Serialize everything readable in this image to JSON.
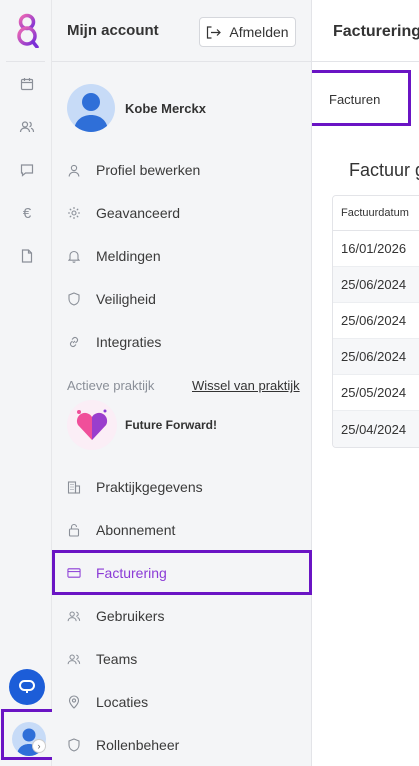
{
  "header": {
    "title": "Mijn account",
    "logout_label": "Afmelden"
  },
  "user": {
    "name": "Kobe Merckx"
  },
  "menu": {
    "items": [
      {
        "label": "Profiel bewerken",
        "icon": "user-icon"
      },
      {
        "label": "Geavanceerd",
        "icon": "gear-icon"
      },
      {
        "label": "Meldingen",
        "icon": "bell-icon"
      },
      {
        "label": "Veiligheid",
        "icon": "shield-icon"
      },
      {
        "label": "Integraties",
        "icon": "link-icon"
      }
    ],
    "practice_section_label": "Actieve praktijk",
    "switch_practice_label": "Wissel van praktijk",
    "practice_name": "Future Forward!",
    "practice_items": [
      {
        "label": "Praktijkgegevens",
        "icon": "building-icon"
      },
      {
        "label": "Abonnement",
        "icon": "lock-icon"
      },
      {
        "label": "Facturering",
        "icon": "credit-card-icon",
        "active": true
      },
      {
        "label": "Gebruikers",
        "icon": "users-icon"
      },
      {
        "label": "Teams",
        "icon": "team-icon"
      },
      {
        "label": "Locaties",
        "icon": "location-pin-icon"
      },
      {
        "label": "Rollenbeheer",
        "icon": "shield-icon"
      }
    ]
  },
  "main": {
    "title": "Facturering",
    "tab_label": "Facturen",
    "section_title": "Factuur geschiedenis",
    "table": {
      "column_header": "Factuurdatum",
      "rows": [
        "16/01/2026",
        "25/06/2024",
        "25/06/2024",
        "25/06/2024",
        "25/05/2024",
        "25/04/2024"
      ]
    }
  },
  "colors": {
    "accent": "#8b3bd6",
    "highlight_border": "#6a14c4",
    "chat_button": "#1c5dd8"
  }
}
